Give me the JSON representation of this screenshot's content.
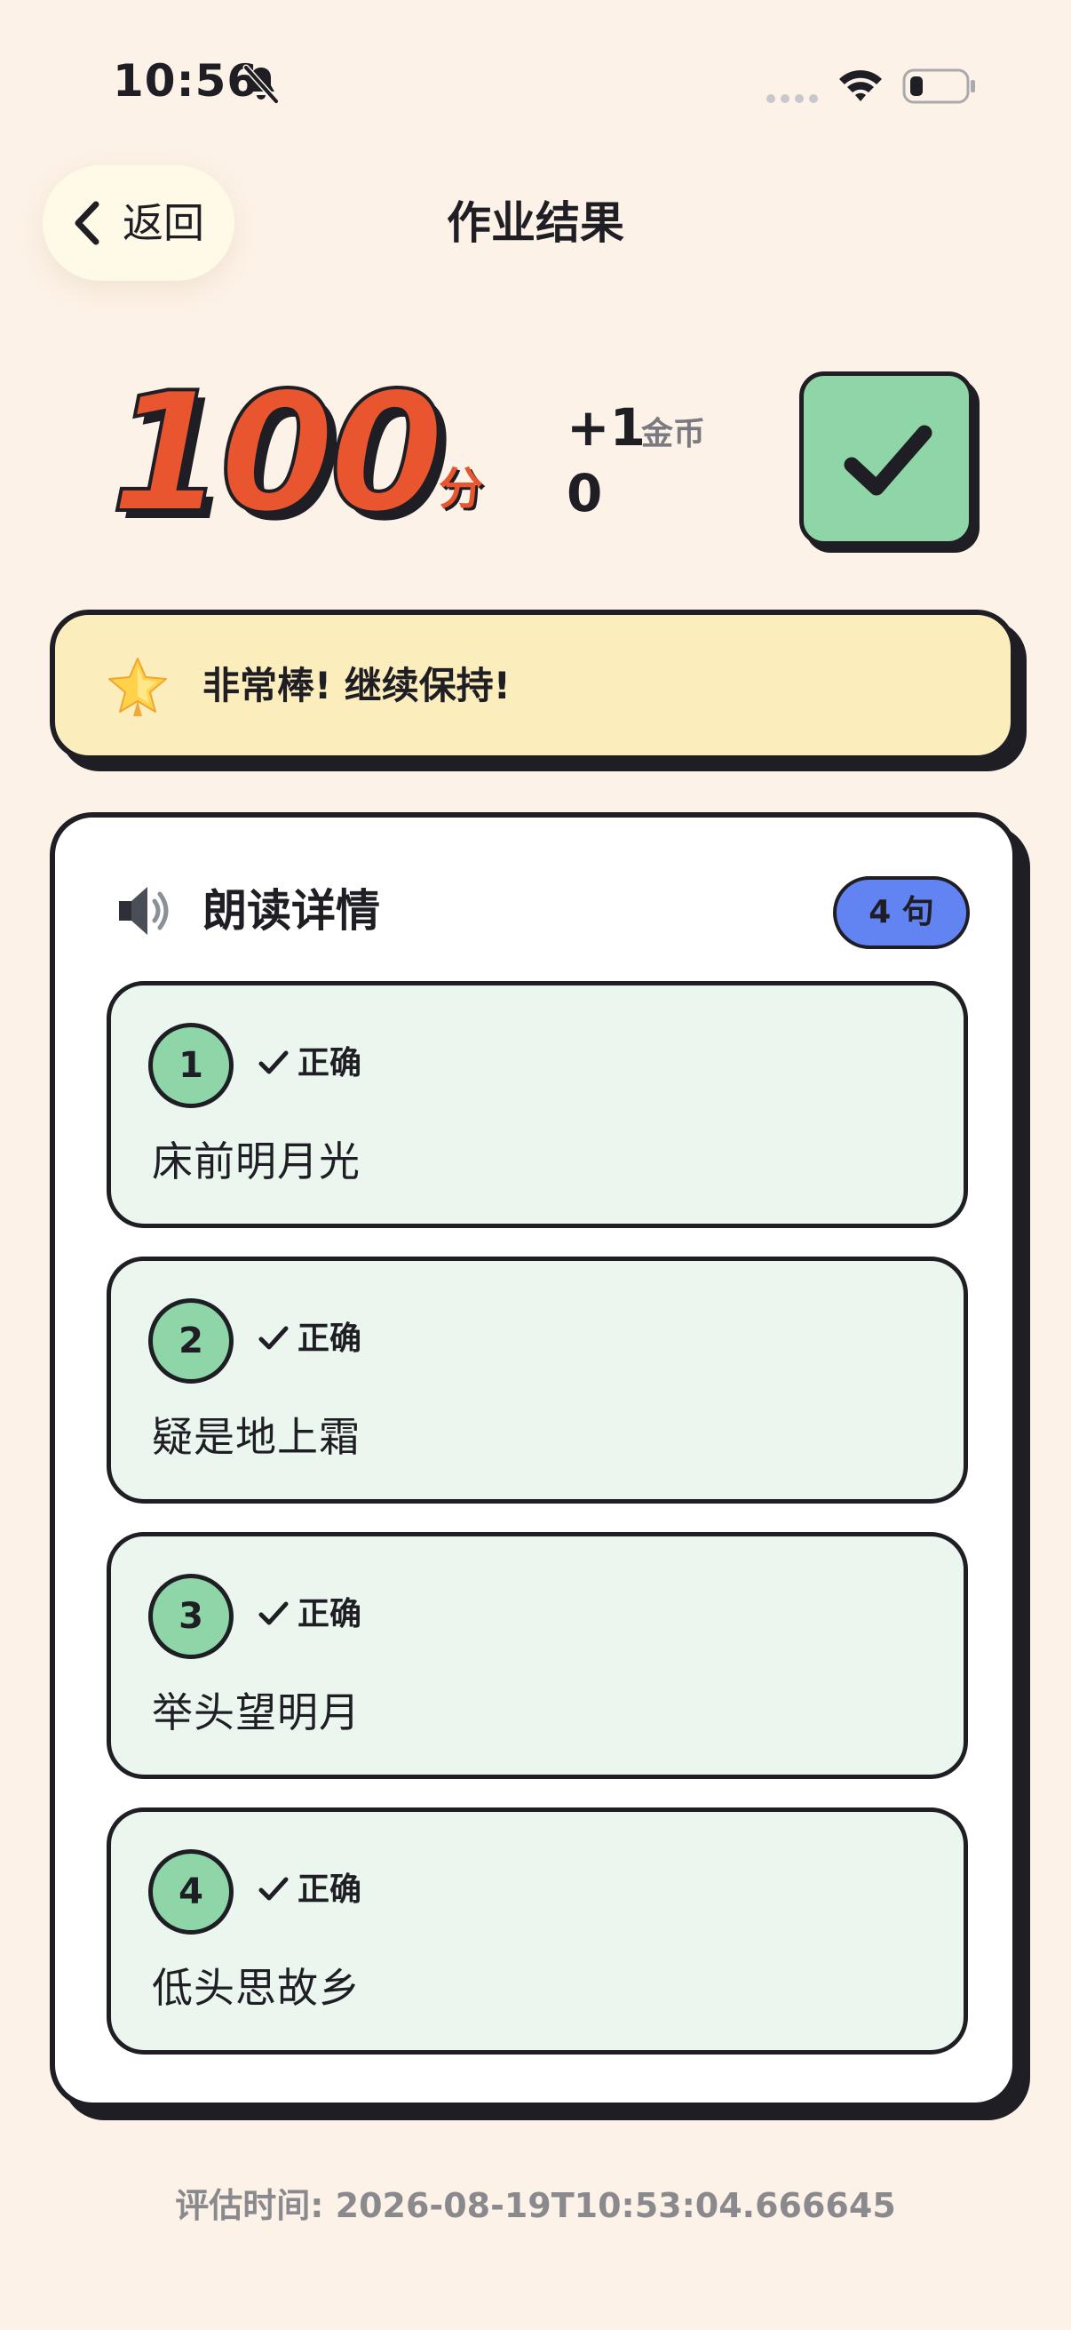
{
  "status_bar": {
    "time": "10:56"
  },
  "nav": {
    "back_label": "返回",
    "title": "作业结果"
  },
  "score": {
    "value": "100",
    "unit": "分",
    "coin_gain": "+1",
    "coin_label": "金币",
    "coin_total": "0"
  },
  "praise": {
    "text": "非常棒! 继续保持!"
  },
  "details": {
    "title": "朗读详情",
    "count_badge": "4 句",
    "sentences": [
      {
        "index": "1",
        "status": "正确",
        "text": "床前明月光"
      },
      {
        "index": "2",
        "status": "正确",
        "text": "疑是地上霜"
      },
      {
        "index": "3",
        "status": "正确",
        "text": "举头望明月"
      },
      {
        "index": "4",
        "status": "正确",
        "text": "低头思故乡"
      }
    ]
  },
  "footer": {
    "eval_label": "评估时间:",
    "eval_time": "2026-08-19T10:53:04.666645"
  },
  "colors": {
    "background": "#FDF2E7",
    "score_orange": "#E9552E",
    "success_green": "#8ED6A8",
    "sentence_bg": "#EAF6EE",
    "praise_bg": "#FCEDBD",
    "badge_blue": "#6284F3",
    "ink": "#1E1E24"
  },
  "icons": {
    "silent": "bell-slash-icon",
    "wifi": "wifi-icon",
    "battery": "battery-icon",
    "back": "chevron-left-icon",
    "result": "check-icon",
    "praise": "star-icon",
    "details": "speaker-icon"
  }
}
